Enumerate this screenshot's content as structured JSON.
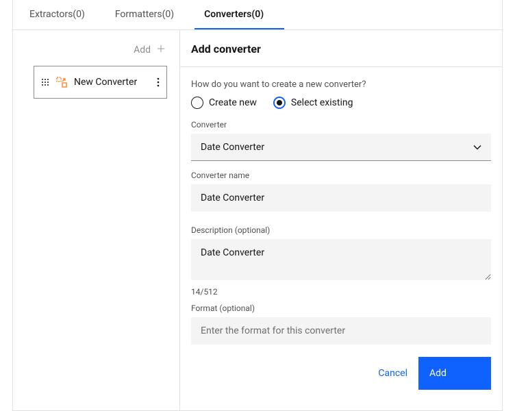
{
  "tabs": [
    {
      "label": "Extractors(0)",
      "active": false
    },
    {
      "label": "Formatters(0)",
      "active": false
    },
    {
      "label": "Converters(0)",
      "active": true
    }
  ],
  "sidebar": {
    "add_label": "Add",
    "items": [
      {
        "label": "New Converter"
      }
    ]
  },
  "panel": {
    "title": "Add converter",
    "prompt": "How do you want to create a new converter?",
    "radios": {
      "create_label": "Create new",
      "select_label": "Select existing",
      "selected": "select_existing"
    },
    "fields": {
      "converter_label": "Converter",
      "converter_value": "Date Converter",
      "name_label": "Converter name",
      "name_value": "Date Converter",
      "description_label": "Description (optional)",
      "description_value": "Date Converter",
      "description_counter": "14/512",
      "format_label": "Format (optional)",
      "format_placeholder": "Enter the format for this converter",
      "format_value": ""
    },
    "footer": {
      "cancel": "Cancel",
      "add": "Add"
    }
  }
}
